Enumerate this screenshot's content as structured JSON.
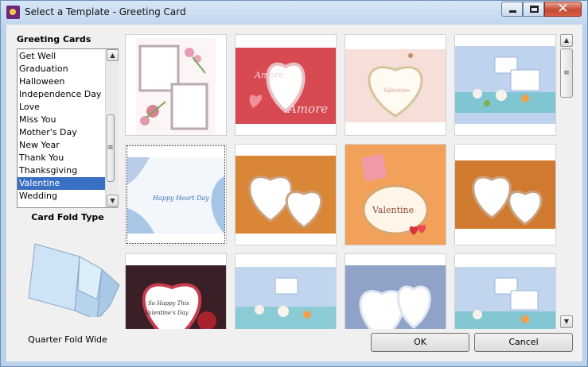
{
  "window": {
    "title": "Select a Template - Greeting Card",
    "close_glyph": "✕"
  },
  "left_panel": {
    "category_heading": "Greeting Cards",
    "categories": [
      "Get Well",
      "Graduation",
      "Halloween",
      "Independence Day",
      "Love",
      "Miss You",
      "Mother's Day",
      "New Year",
      "Thank You",
      "Thanksgiving",
      "Valentine",
      "Wedding"
    ],
    "selected_category": "Valentine",
    "fold_heading": "Card Fold Type",
    "fold_label": "Quarter Fold Wide"
  },
  "gallery": {
    "card_texts": {
      "amore": "Amore",
      "happy_heart_day": "Happy Heart Day",
      "valentine": "Valentine",
      "so_happy_1": "So Happy This",
      "so_happy_2": "Valentine's Day"
    }
  },
  "scroll_glyphs": {
    "up": "▲",
    "down": "▼",
    "grip": "≡"
  },
  "buttons": {
    "ok": "OK",
    "cancel": "Cancel"
  },
  "colors": {
    "selection": "#3b6fc4",
    "title_bar": "#c1d6ee",
    "close_button": "#c44a35"
  }
}
